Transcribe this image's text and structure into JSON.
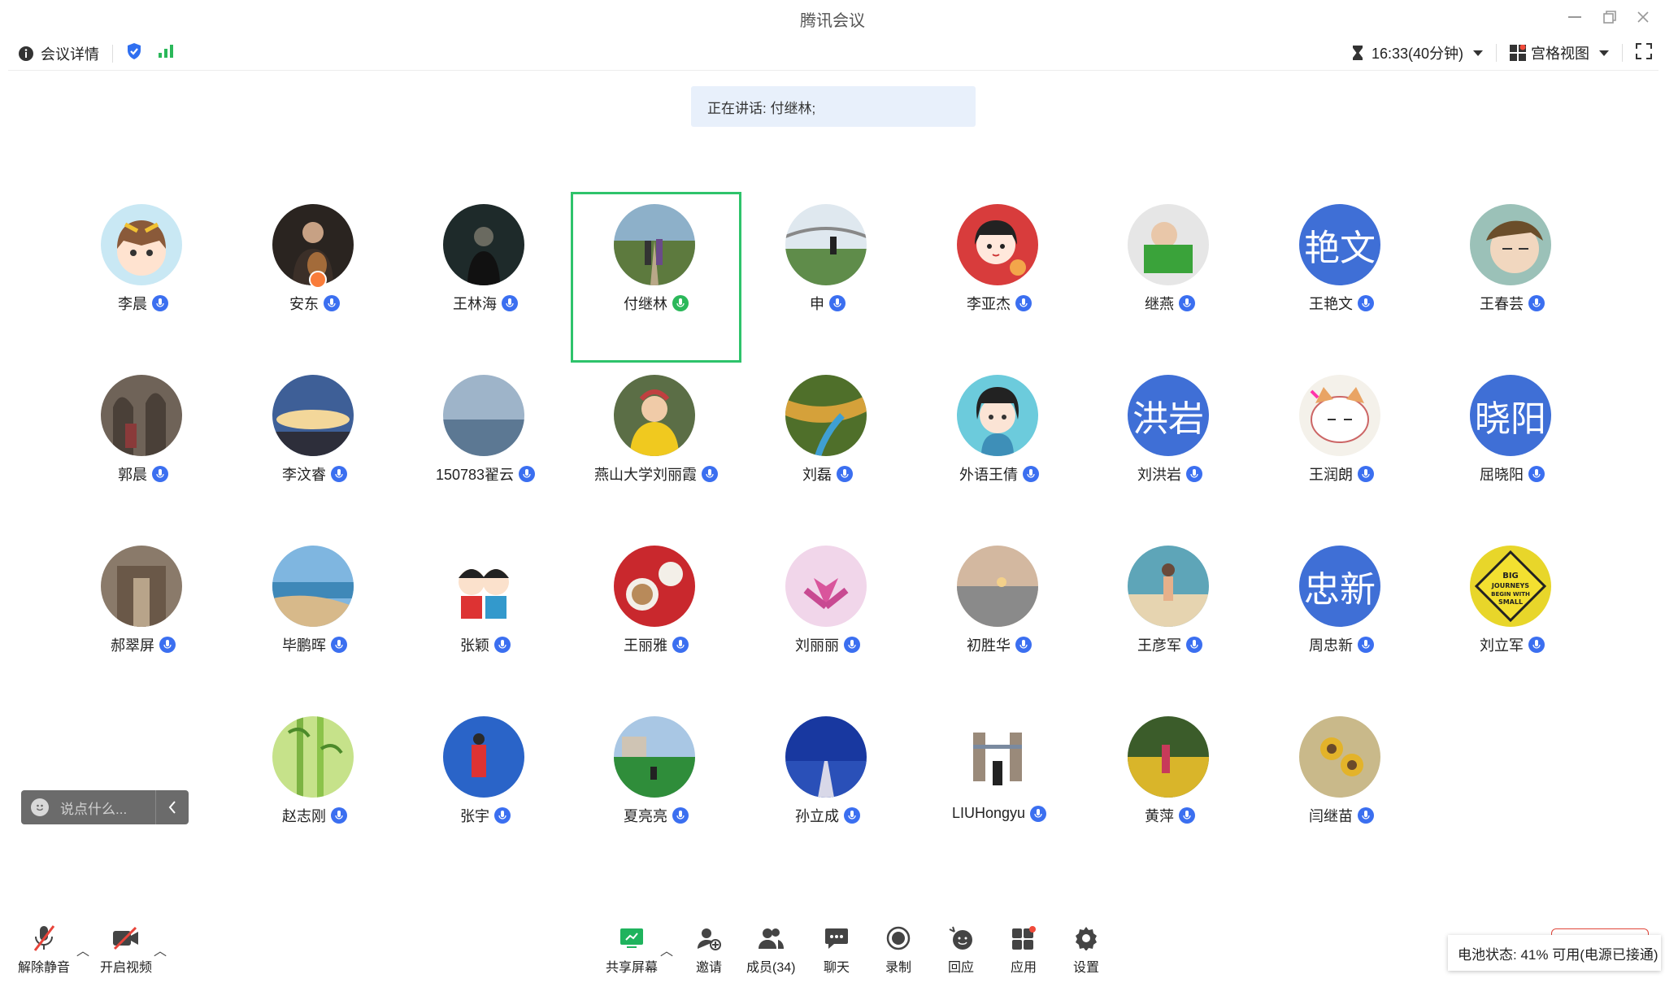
{
  "app": {
    "title": "腾讯会议"
  },
  "toolbar": {
    "meeting_details": "会议详情",
    "timer": "16:33(40分钟)",
    "view_mode": "宫格视图"
  },
  "speaking": "正在讲话: 付继林;",
  "participants": [
    {
      "name": "李晨",
      "avatar": "cartoon-girl",
      "mic": "blue"
    },
    {
      "name": "安东",
      "avatar": "photo-man-guitar",
      "mic": "blue",
      "host": true
    },
    {
      "name": "王林海",
      "avatar": "photo-dark",
      "mic": "blue"
    },
    {
      "name": "付继林",
      "avatar": "photo-couple-path",
      "mic": "green",
      "speaking": true
    },
    {
      "name": "申",
      "avatar": "photo-bridge",
      "mic": "blue"
    },
    {
      "name": "李亚杰",
      "avatar": "cartoon-girl-red",
      "mic": "blue"
    },
    {
      "name": "继燕",
      "avatar": "photo-child-basket",
      "mic": "blue"
    },
    {
      "name": "王艳文",
      "avatar": "text",
      "avatar_text": "艳文",
      "mic": "blue"
    },
    {
      "name": "王春芸",
      "avatar": "anime-boy",
      "mic": "blue"
    },
    {
      "name": "郭晨",
      "avatar": "photo-cave",
      "mic": "blue"
    },
    {
      "name": "李汶睿",
      "avatar": "photo-sky",
      "mic": "blue"
    },
    {
      "name": "150783翟云",
      "avatar": "photo-sea",
      "mic": "blue"
    },
    {
      "name": "燕山大学刘丽霞",
      "avatar": "photo-baby-yellow",
      "mic": "blue"
    },
    {
      "name": "刘磊",
      "avatar": "photo-river-valley",
      "mic": "blue"
    },
    {
      "name": "外语王倩",
      "avatar": "anime-girl",
      "mic": "blue"
    },
    {
      "name": "刘洪岩",
      "avatar": "text",
      "avatar_text": "洪岩",
      "mic": "blue"
    },
    {
      "name": "王润朗",
      "avatar": "cartoon-cat",
      "mic": "blue"
    },
    {
      "name": "屈晓阳",
      "avatar": "text",
      "avatar_text": "晓阳",
      "mic": "blue"
    },
    {
      "name": "郝翠屏",
      "avatar": "photo-hall",
      "mic": "blue"
    },
    {
      "name": "毕鹏晖",
      "avatar": "photo-beach",
      "mic": "blue"
    },
    {
      "name": "张颖",
      "avatar": "cartoon-couple",
      "mic": "blue"
    },
    {
      "name": "王丽雅",
      "avatar": "photo-coffee",
      "mic": "blue"
    },
    {
      "name": "刘丽丽",
      "avatar": "photo-flower",
      "mic": "blue"
    },
    {
      "name": "初胜华",
      "avatar": "photo-sunset-lake",
      "mic": "blue"
    },
    {
      "name": "王彦军",
      "avatar": "photo-child-beach",
      "mic": "blue"
    },
    {
      "name": "周忠新",
      "avatar": "text",
      "avatar_text": "忠新",
      "mic": "blue"
    },
    {
      "name": "刘立军",
      "avatar": "sign-yellow",
      "avatar_text": "BIG JOURNEYS BEGIN WITH SMALL STEPS",
      "mic": "blue"
    },
    {
      "name": "赵志刚",
      "avatar": "bamboo",
      "mic": "blue"
    },
    {
      "name": "张宇",
      "avatar": "photo-blue-sky",
      "mic": "blue"
    },
    {
      "name": "夏亮亮",
      "avatar": "photo-field",
      "mic": "blue"
    },
    {
      "name": "孙立成",
      "avatar": "photo-road",
      "mic": "blue"
    },
    {
      "name": "LIUHongyu",
      "avatar": "photo-tower-bridge",
      "mic": "blue"
    },
    {
      "name": "黄萍",
      "avatar": "photo-flowers-field",
      "mic": "blue"
    },
    {
      "name": "闫继苗",
      "avatar": "sunflowers",
      "mic": "blue"
    }
  ],
  "chat_quick": {
    "placeholder": "说点什么..."
  },
  "bottom": {
    "unmute": "解除静音",
    "start_video": "开启视频",
    "share_screen": "共享屏幕",
    "invite": "邀请",
    "members": "成员(34)",
    "chat": "聊天",
    "record": "录制",
    "react": "回应",
    "apps": "应用",
    "settings": "设置"
  },
  "battery": "电池状态: 41% 可用(电源已接通)"
}
